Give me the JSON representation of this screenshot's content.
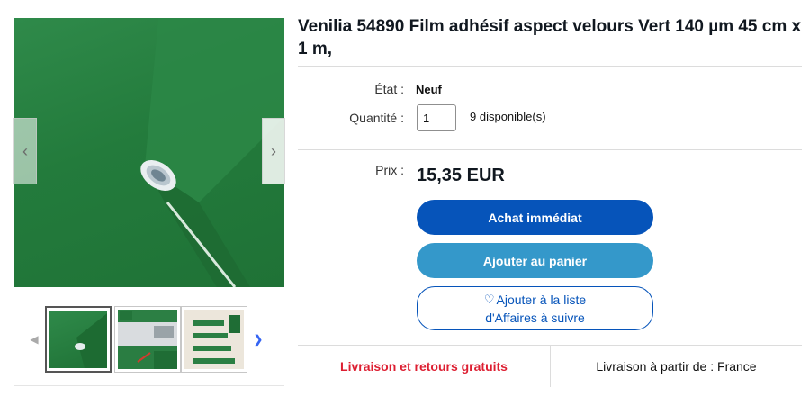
{
  "listing": {
    "title": "Venilia 54890 Film adhésif aspect velours Vert 140 µm 45 cm x 1 m,",
    "condition_label": "État :",
    "condition_value": "Neuf",
    "quantity_label": "Quantité :",
    "quantity_value": "1",
    "availability": "9 disponible(s)",
    "price_label": "Prix :",
    "price": "15,35 EUR"
  },
  "actions": {
    "buy_now": "Achat immédiat",
    "add_to_cart": "Ajouter au panier",
    "watch_line1": "Ajouter à la liste",
    "watch_line2": "d'Affaires à suivre"
  },
  "shipping": {
    "free": "Livraison et retours gratuits",
    "from": "Livraison à partir de : France"
  },
  "gallery": {
    "prev_icon": "chevron-left-icon",
    "next_icon": "chevron-right-icon",
    "thumbnails": [
      "green-film-roll",
      "kitchen-with-green-cabinets",
      "staircase-with-green-steps"
    ]
  },
  "colors": {
    "buy_button": "#0654ba",
    "cart_button": "#3498ca",
    "free_shipping": "#dd1e31",
    "product_green": "#237b3c"
  }
}
